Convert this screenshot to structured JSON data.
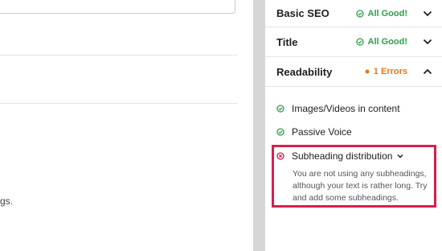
{
  "editor": {
    "partial_text": "gs."
  },
  "sidebar": {
    "sections": [
      {
        "title": "Basic SEO",
        "status": "All Good!",
        "status_type": "good",
        "expanded": false
      },
      {
        "title": "Title",
        "status": "All Good!",
        "status_type": "good",
        "expanded": false
      },
      {
        "title": "Readability",
        "status": "1 Errors",
        "status_type": "error",
        "expanded": true
      }
    ],
    "checks": [
      {
        "label": "Images/Videos in content",
        "state": "pass"
      },
      {
        "label": "Passive Voice",
        "state": "pass"
      },
      {
        "label": "Subheading distribution",
        "state": "fail",
        "description": "You are not using any subheadings, although your text is rather long. Try and add some subheadings."
      }
    ]
  },
  "colors": {
    "good": "#2e9e49",
    "error_status": "#e77919",
    "fail_icon": "#d6204e",
    "highlight_border": "#d6204e"
  }
}
